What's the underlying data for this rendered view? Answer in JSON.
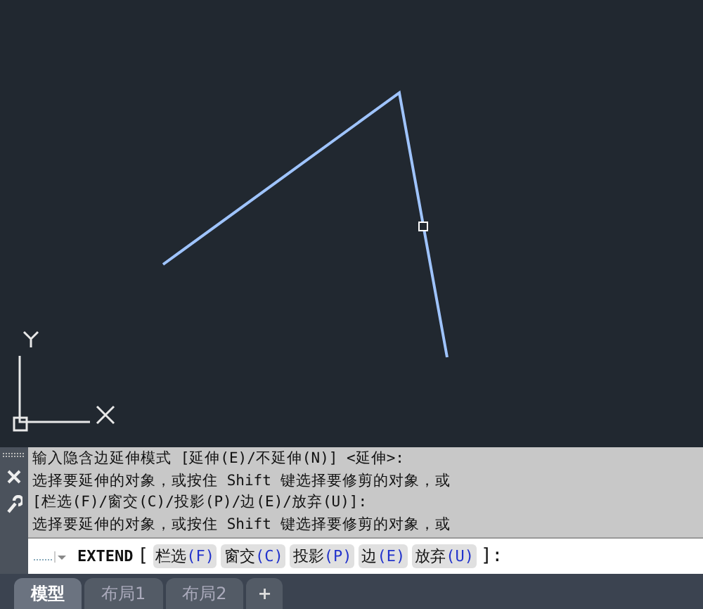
{
  "command_history": [
    "输入隐含边延伸模式 [延伸(E)/不延伸(N)] <延伸>:",
    "选择要延伸的对象，或按住 Shift 键选择要修剪的对象，或",
    "[栏选(F)/窗交(C)/投影(P)/边(E)/放弃(U)]:",
    "选择要延伸的对象，或按住 Shift 键选择要修剪的对象，或"
  ],
  "command_line": {
    "command": "EXTEND",
    "open": "[",
    "close": "]:",
    "options": [
      {
        "label": "栏选",
        "key": "(F)"
      },
      {
        "label": "窗交",
        "key": "(C)"
      },
      {
        "label": "投影",
        "key": "(P)"
      },
      {
        "label": "边",
        "key": "(E)"
      },
      {
        "label": "放弃",
        "key": "(U)"
      }
    ]
  },
  "layout_tabs": [
    {
      "label": "模型",
      "selected": true
    },
    {
      "label": "布局1",
      "selected": false
    },
    {
      "label": "布局2",
      "selected": false
    }
  ],
  "add_tab": "+"
}
